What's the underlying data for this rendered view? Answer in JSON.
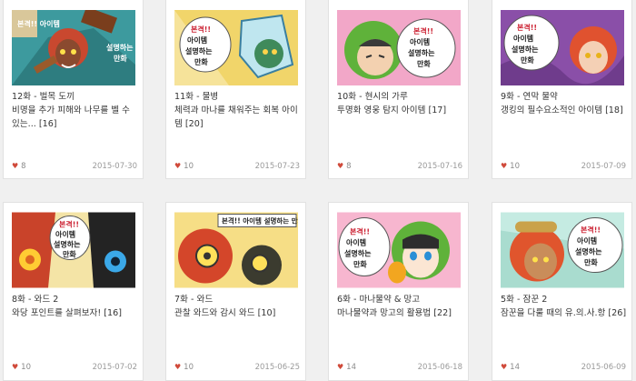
{
  "cards": [
    {
      "title": "12화 - 벌목 도끼",
      "desc": "비명을 추가 피해와 나무를 벨 수 있는... [16]",
      "likes": "8",
      "date": "2015-07-30",
      "bubble": "본격!! 아이템 설명하는 만화"
    },
    {
      "title": "11화 - 물병",
      "desc": "체력과 마나를 채워주는 회복 아이템 [20]",
      "likes": "10",
      "date": "2015-07-23",
      "bubble": "본격!! 아이템 설명하는 만화"
    },
    {
      "title": "10화 - 현시의 가루",
      "desc": "투명화 영웅 탐지 아이템 [17]",
      "likes": "8",
      "date": "2015-07-16",
      "bubble": "본격!! 아이템 설명하는 만화"
    },
    {
      "title": "9화 - 연막 물약",
      "desc": "갱킹의 필수요소적인 아이템 [18]",
      "likes": "10",
      "date": "2015-07-09",
      "bubble": "본격!! 아이템 설명하는 만화"
    },
    {
      "title": "8화 - 와드 2",
      "desc": "와당 포인트를 살펴보자! [16]",
      "likes": "10",
      "date": "2015-07-02",
      "bubble": "본격!! 아이템 설명하는 만화"
    },
    {
      "title": "7화 - 와드",
      "desc": "관찰 와드와 감시 와드 [10]",
      "likes": "10",
      "date": "2015-06-25",
      "bubble": "본격!! 아이템 설명하는 만화"
    },
    {
      "title": "6화 - 마나물약 & 망고",
      "desc": "마나물약과 망고의 활용법 [22]",
      "likes": "14",
      "date": "2015-06-18",
      "bubble": "본격!! 아이템 설명하는 만화"
    },
    {
      "title": "5화 - 잠꾼 2",
      "desc": "잠꾼을 다룰 때의 유.의.사.항 [26]",
      "likes": "14",
      "date": "2015-06-09",
      "bubble": "본격!! 아이템 설명하는 만화"
    }
  ]
}
